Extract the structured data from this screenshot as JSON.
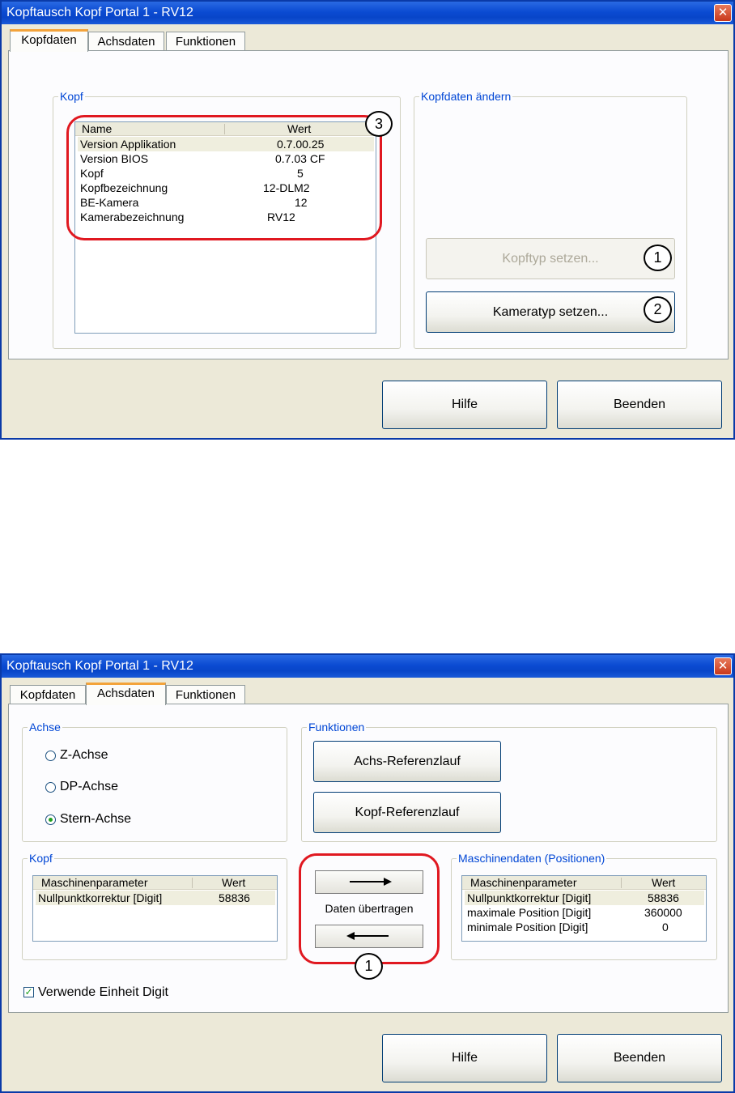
{
  "window1": {
    "title": "Kopftausch Kopf Portal 1 - RV12",
    "close_glyph": "✕",
    "tabs": [
      "Kopfdaten",
      "Achsdaten",
      "Funktionen"
    ],
    "active_tab": 0,
    "kopf_group": {
      "label": "Kopf",
      "columns": [
        "Name",
        "Wert"
      ],
      "rows": [
        {
          "name": "Version Applikation",
          "value": "0.7.00.25"
        },
        {
          "name": "Version BIOS",
          "value": "0.7.03 CF"
        },
        {
          "name": "Kopf",
          "value": "5"
        },
        {
          "name": "Kopfbezeichnung",
          "value": "12-DLM2"
        },
        {
          "name": "BE-Kamera",
          "value": "12"
        },
        {
          "name": "Kamerabezeichnung",
          "value": "RV12"
        }
      ]
    },
    "change_group": {
      "label": "Kopfdaten ändern",
      "kopftyp_button": "Kopftyp setzen...",
      "kameratyp_button": "Kameratyp setzen..."
    },
    "callouts": [
      "1",
      "2",
      "3"
    ],
    "help_button": "Hilfe",
    "exit_button": "Beenden"
  },
  "window2": {
    "title": "Kopftausch Kopf Portal 1 - RV12",
    "close_glyph": "✕",
    "tabs": [
      "Kopfdaten",
      "Achsdaten",
      "Funktionen"
    ],
    "active_tab": 1,
    "achse_group": {
      "label": "Achse",
      "options": [
        "Z-Achse",
        "DP-Achse",
        "Stern-Achse"
      ],
      "selected": "Stern-Achse"
    },
    "funktionen_group": {
      "label": "Funktionen",
      "achs_ref_button": "Achs-Referenzlauf",
      "kopf_ref_button": "Kopf-Referenzlauf"
    },
    "kopf_group": {
      "label": "Kopf",
      "columns": [
        "Maschinenparameter",
        "Wert"
      ],
      "rows": [
        {
          "name": "Nullpunktkorrektur [Digit]",
          "value": "58836"
        }
      ]
    },
    "transfer": {
      "label": "Daten übertragen",
      "right_arrow": "⟶",
      "left_arrow": "⟵",
      "callout": "1"
    },
    "maschinen_group": {
      "label": "Maschinendaten (Positionen)",
      "columns": [
        "Maschinenparameter",
        "Wert"
      ],
      "rows": [
        {
          "name": "Nullpunktkorrektur [Digit]",
          "value": "58836"
        },
        {
          "name": "maximale Position [Digit]",
          "value": "360000"
        },
        {
          "name": "minimale Position [Digit]",
          "value": "0"
        }
      ]
    },
    "use_digit_label": "Verwende Einheit Digit",
    "use_digit_checked": true,
    "help_button": "Hilfe",
    "exit_button": "Beenden"
  }
}
